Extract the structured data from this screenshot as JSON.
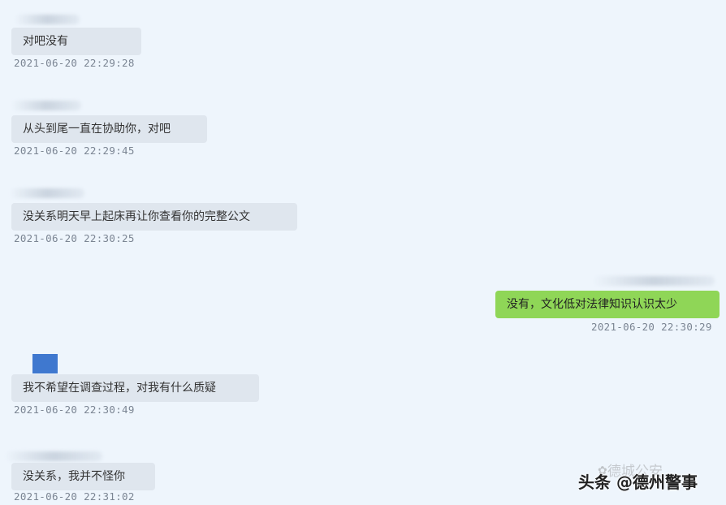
{
  "messages": [
    {
      "text": "对吧没有",
      "time": "2021-06-20 22:29:28"
    },
    {
      "text": "从头到尾一直在协助你，对吧",
      "time": "2021-06-20 22:29:45"
    },
    {
      "text": "没关系明天早上起床再让你查看你的完整公文",
      "time": "2021-06-20 22:30:25"
    },
    {
      "text": "没有，文化低对法律知识认识太少",
      "time": "2021-06-20 22:30:29"
    },
    {
      "text": "我不希望在调查过程，对我有什么质疑",
      "time": "2021-06-20 22:30:49"
    },
    {
      "text": "没关系，我并不怪你",
      "time": "2021-06-20 22:31:02"
    }
  ],
  "watermark": {
    "main": "头条 @德州警事",
    "faint": "德城公安",
    "icon": "wechat-logo-icon"
  },
  "colors": {
    "background": "#eef5fc",
    "incoming_bubble": "#dfe6ee",
    "outgoing_bubble": "#8fd657",
    "avatar": "#3f78cf"
  }
}
